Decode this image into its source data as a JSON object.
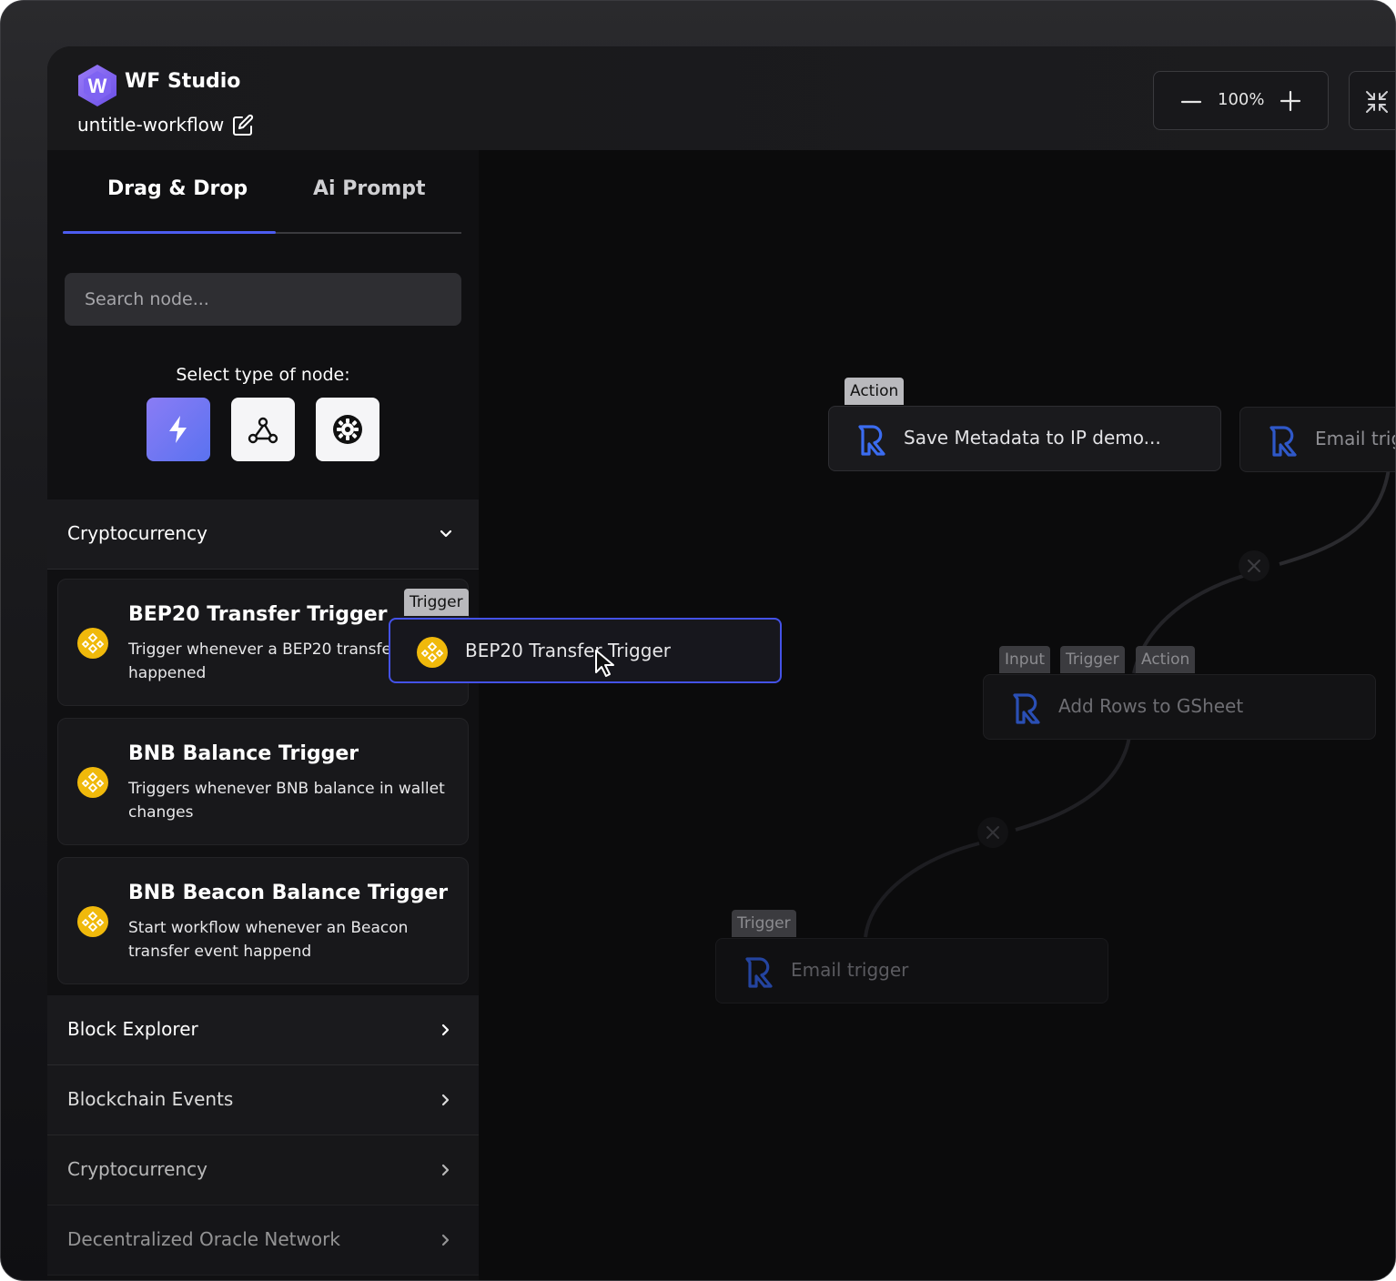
{
  "header": {
    "app_name": "WF Studio",
    "logo_letter": "W",
    "workflow_name": "untitle-workflow",
    "zoom_value": "100%"
  },
  "sidebar": {
    "tabs": [
      {
        "label": "Drag & Drop",
        "active": true
      },
      {
        "label": "Ai Prompt",
        "active": false
      }
    ],
    "search_placeholder": "Search node...",
    "select_type_label": "Select type of node:",
    "node_types": [
      "trigger-bolt-icon",
      "webhook-icon",
      "settings-gear-icon"
    ],
    "expanded_category": "Cryptocurrency",
    "nodes": [
      {
        "title": "BEP20 Transfer Trigger",
        "desc": "Trigger whenever a BEP20 transfer happened"
      },
      {
        "title": "BNB Balance Trigger",
        "desc": "Triggers whenever BNB balance in wallet changes"
      },
      {
        "title": "BNB Beacon Balance Trigger",
        "desc": "Start workflow whenever an Beacon transfer event happend"
      }
    ],
    "categories": [
      "Block Explorer",
      "Blockchain Events",
      "Cryptocurrency",
      "Decentralized Oracle Network"
    ]
  },
  "canvas": {
    "dragging_node": {
      "tag": "Trigger",
      "label": "BEP20 Transfer Trigger"
    },
    "nodes": [
      {
        "tags": [
          "Action"
        ],
        "label": "Save Metadata to IP demo..."
      },
      {
        "tags": [],
        "label": "Email trigger"
      },
      {
        "tags": [
          "Input",
          "Trigger",
          "Action"
        ],
        "label": "Add Rows to GSheet"
      },
      {
        "tags": [
          "Trigger"
        ],
        "label": "Email trigger"
      }
    ]
  },
  "colors": {
    "accent": "#4c5cf0",
    "logo_purple": "#7b5cf0",
    "coin_gold": "#f0b90b",
    "canvas_bg": "#0b0b0c"
  }
}
